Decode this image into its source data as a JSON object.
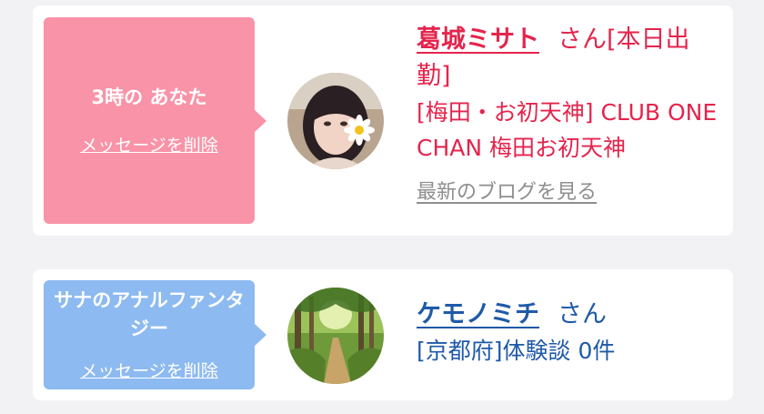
{
  "items": [
    {
      "bubble": {
        "title": "3時の あなた",
        "delete_label": "メッセージを削除",
        "color": "#f993a8"
      },
      "avatar_icon": "profile-photo-woman-with-daisy",
      "name": "葛城ミサト",
      "honorific": "さん",
      "tag_suffix": "[本日出勤]",
      "detail": "[梅田・お初天神] CLUB ONE CHAN 梅田お初天神",
      "blog_link": "最新のブログを見る",
      "text_color": "#e4254d"
    },
    {
      "bubble": {
        "title": "サナのアナルファンタジー",
        "delete_label": "メッセージを削除",
        "color": "#8dbaf0"
      },
      "avatar_icon": "forest-path-photo",
      "name": "ケモノミチ",
      "honorific": "さん",
      "detail": "[京都府]体験談 0件",
      "text_color": "#1f5aa8"
    }
  ]
}
